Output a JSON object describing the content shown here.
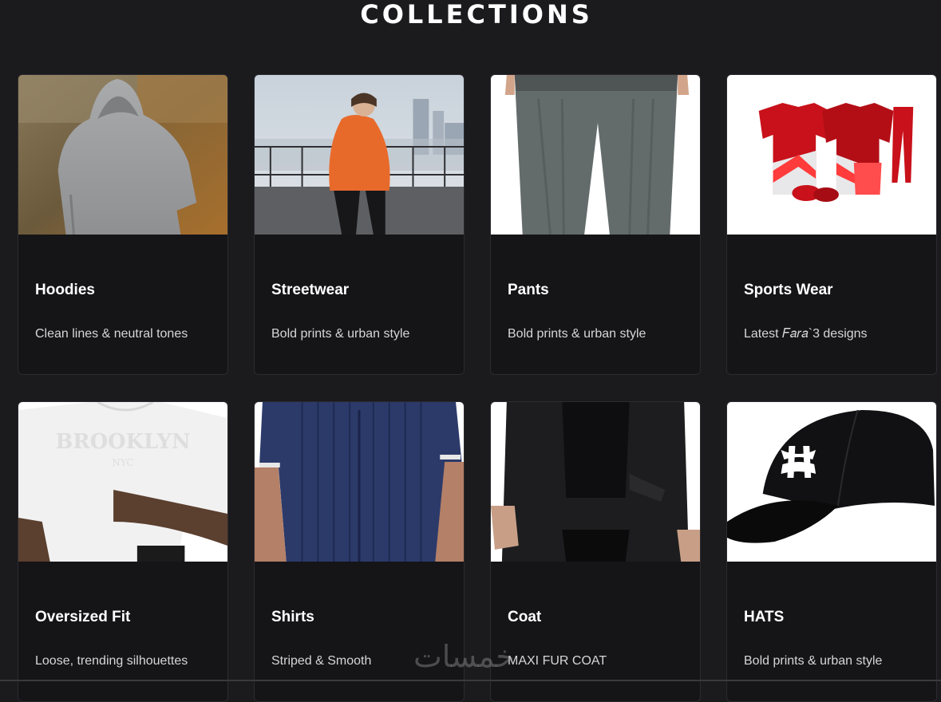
{
  "page": {
    "title": "COLLECTIONS"
  },
  "collections": [
    {
      "title": "Hoodies",
      "description": "Clean lines & neutral tones",
      "image": "grey-hoodie-back-photo"
    },
    {
      "title": "Streetwear",
      "description": "Bold prints & urban style",
      "image": "orange-hoodie-rooftop-photo"
    },
    {
      "title": "Pants",
      "description": "Bold prints & urban style",
      "image": "grey-wide-pants-photo"
    },
    {
      "title": "Sports Wear",
      "description": "Latest 𝐹𝑎𝑟𝑎`3 designs",
      "image": "red-sports-kit-photo"
    },
    {
      "title": "Oversized Fit",
      "description": "Loose, trending silhouettes",
      "image": "white-brooklyn-tee-photo"
    },
    {
      "title": "Shirts",
      "description": "Striped & Smooth",
      "image": "navy-knit-shirt-photo"
    },
    {
      "title": "Coat",
      "description": "MAXI FUR COAT",
      "image": "black-long-coat-photo"
    },
    {
      "title": "HATS",
      "description": "Bold prints & urban style",
      "image": "black-cap-photo"
    }
  ],
  "watermark": {
    "text": "خمسات"
  },
  "colors": {
    "background": "#1b1a1d",
    "card_background": "#151417",
    "card_border": "#2c2b30",
    "text_primary": "#ffffff",
    "text_secondary": "#d6d6d9"
  }
}
